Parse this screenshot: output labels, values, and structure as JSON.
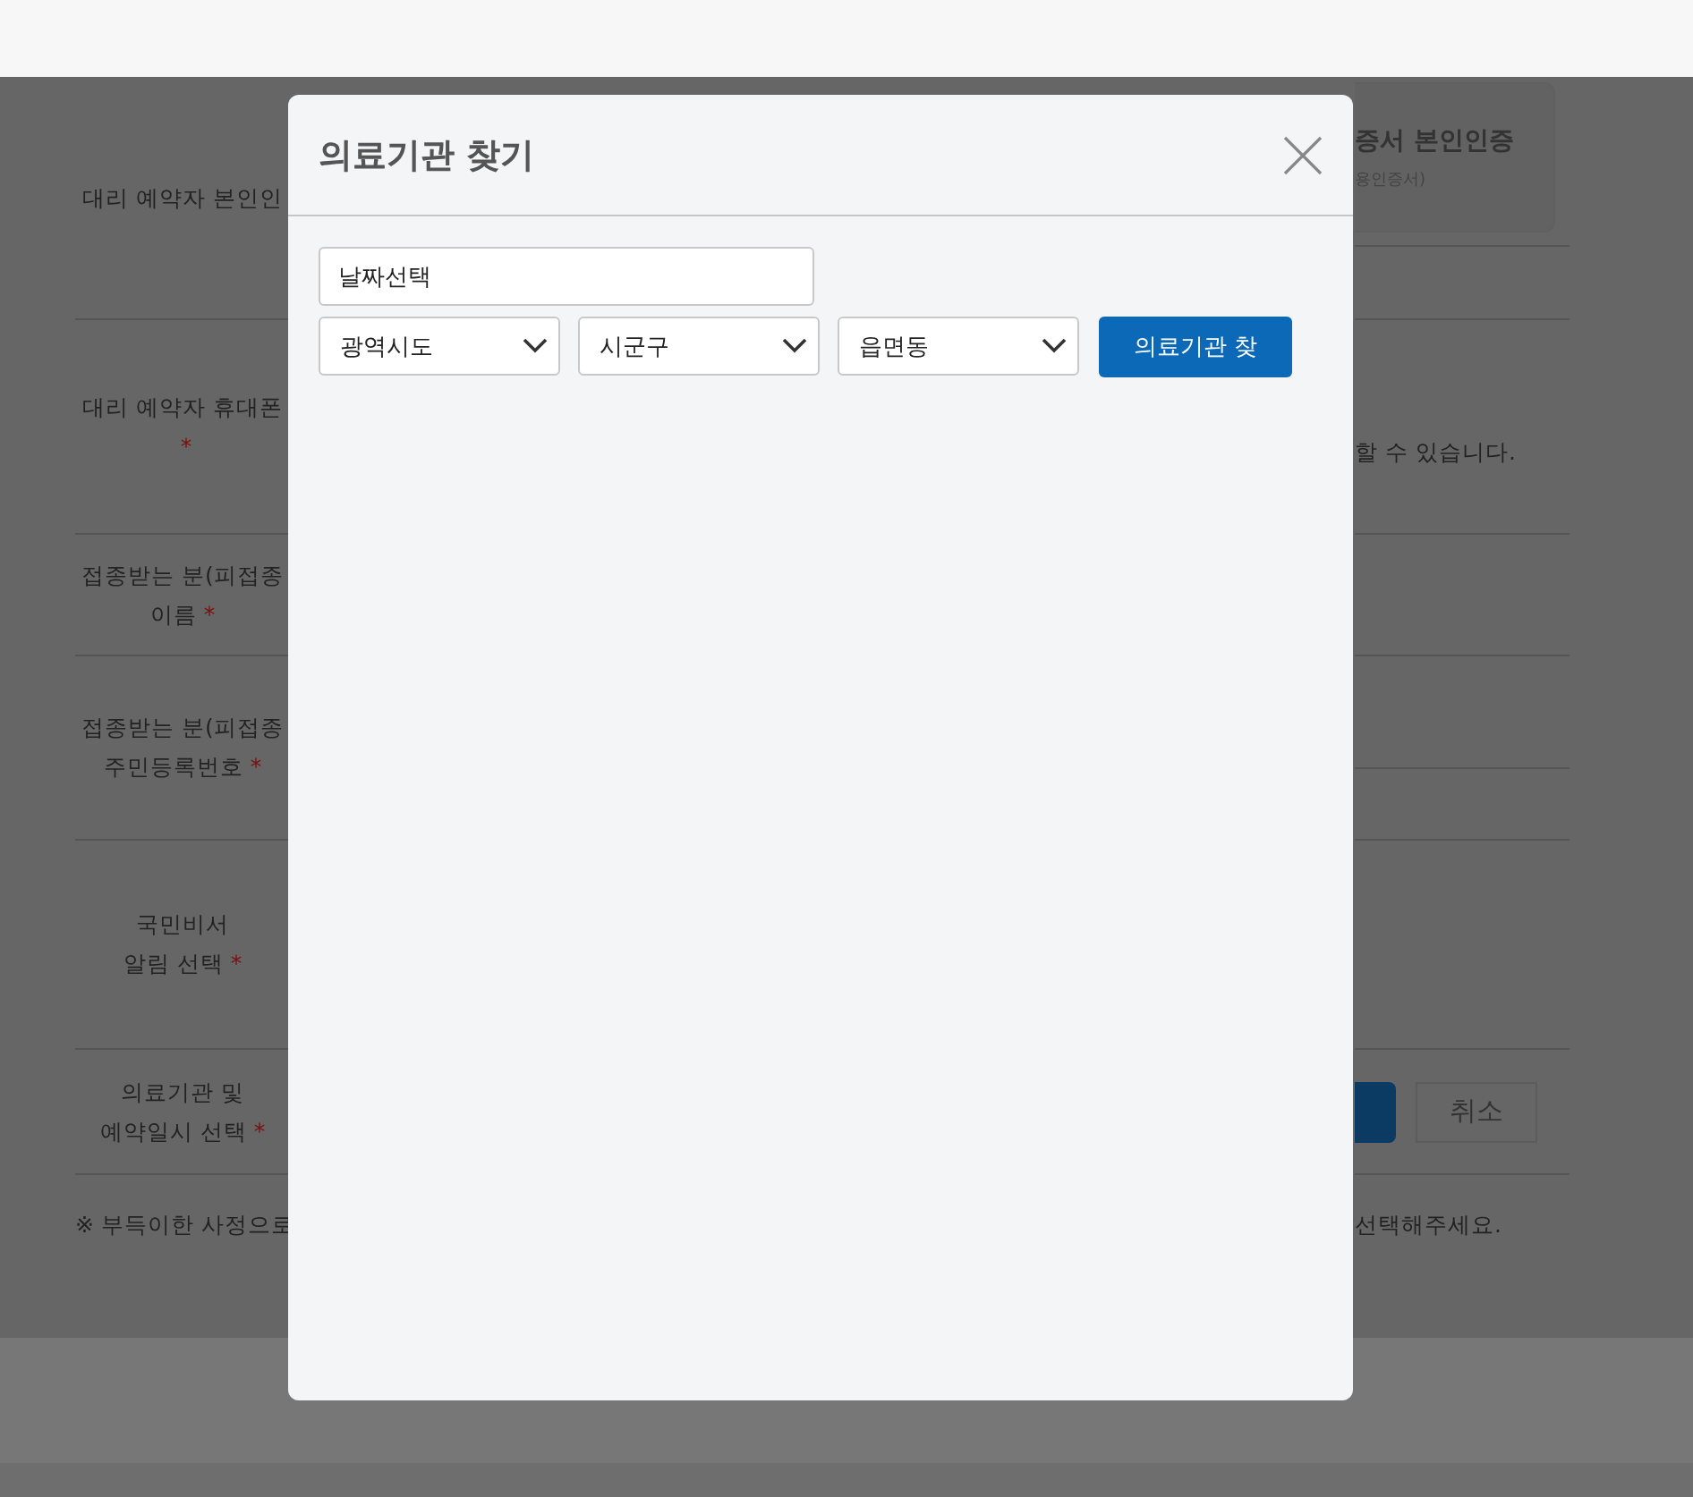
{
  "background_form": {
    "labels": [
      {
        "text": "대리 예약자 본인인"
      },
      {
        "text": "대리 예약자 휴대폰",
        "required_mark": "*"
      },
      {
        "text": "접종받는 분(피접종\n이름",
        "required_mark": "*"
      },
      {
        "text": "접종받는 분(피접종\n주민등록번호",
        "required_mark": "*"
      },
      {
        "text": "국민비서\n알림 선택",
        "required_mark": "*"
      },
      {
        "text": "의료기관 및\n예약일시 선택",
        "required_mark": "*"
      }
    ],
    "auth_button": {
      "title": "증서 본인인증",
      "subtitle": "용인증서)"
    },
    "phone_note": "할 수 있습니다.",
    "cancel_button": "취소",
    "footnote_left": "※ 부득이한 사정으로",
    "footnote_right": "선택해주세요."
  },
  "modal": {
    "title": "의료기관 찾기",
    "date_field": {
      "value": "날짜선택"
    },
    "selects": [
      {
        "value": "광역시도"
      },
      {
        "value": "시군구"
      },
      {
        "value": "읍면동"
      }
    ],
    "search_button": "의료기관 찾"
  }
}
